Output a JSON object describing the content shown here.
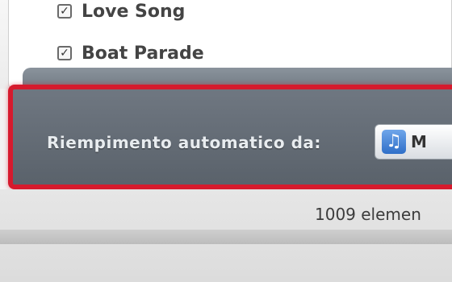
{
  "playlist": {
    "items": [
      {
        "label": "Love Song",
        "checked": true
      },
      {
        "label": "Boat Parade",
        "checked": true
      }
    ]
  },
  "autofill": {
    "label": "Riempimento automatico da:",
    "source_label": "M",
    "source_icon": "music-note-icon"
  },
  "status": {
    "item_count": "1009 elemen"
  },
  "colors": {
    "highlight_border": "#d61a2d",
    "bar": "#6f7781",
    "music_icon": "#2f6fc8"
  }
}
